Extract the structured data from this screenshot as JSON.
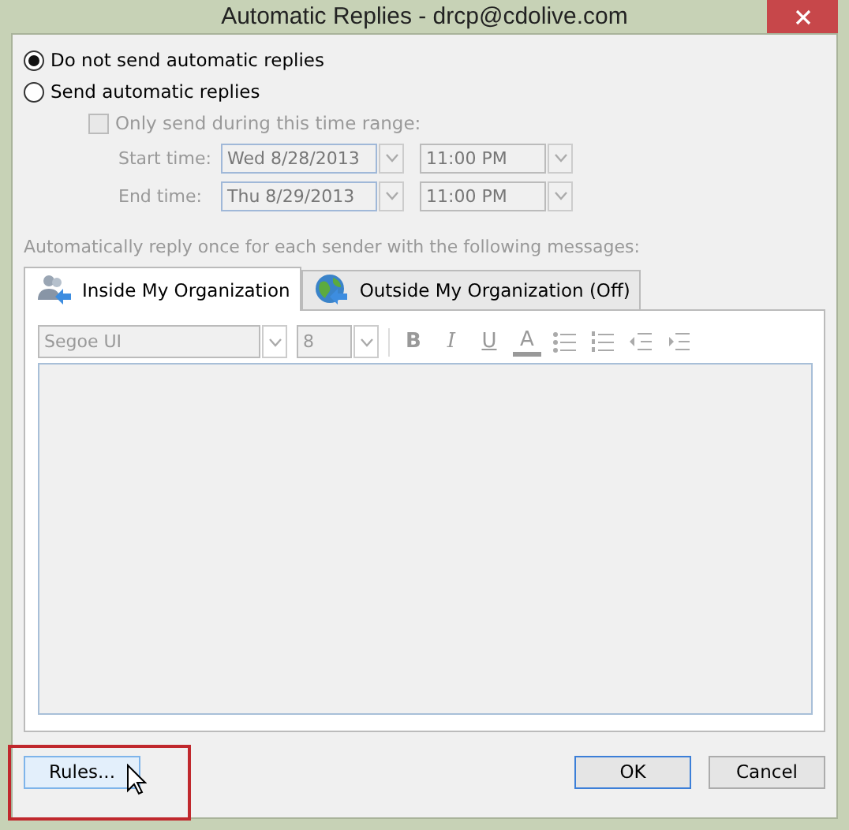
{
  "window": {
    "title": "Automatic Replies - drcp@cdolive.com"
  },
  "modes": [
    {
      "label": "Do not send automatic replies",
      "selected": true
    },
    {
      "label": "Send automatic replies",
      "selected": false
    }
  ],
  "time_range": {
    "label": "Only send during this time range:",
    "checked": false,
    "disabled": true,
    "rows": [
      {
        "label": "Start time:",
        "date": "Wed 8/28/2013",
        "time": "11:00 PM"
      },
      {
        "label": "End time:",
        "date": "Thu 8/29/2013",
        "time": "11:00 PM"
      }
    ]
  },
  "description": "Automatically reply once for each sender with the following messages:",
  "tabs": [
    {
      "label": "Inside My Organization",
      "selected": true,
      "kind": "people"
    },
    {
      "label": "Outside My Organization (Off)",
      "selected": false,
      "kind": "globe"
    }
  ],
  "editor": {
    "font": "Segoe UI",
    "size": "8",
    "disabled": true,
    "tools": [
      {
        "kind": "bold",
        "text": "B"
      },
      {
        "kind": "italic",
        "text": "I"
      },
      {
        "kind": "underline",
        "text": "U"
      },
      {
        "kind": "color",
        "text": "A"
      },
      {
        "kind": "bullets"
      },
      {
        "kind": "numbering"
      },
      {
        "kind": "outdent"
      },
      {
        "kind": "indent"
      }
    ]
  },
  "buttons": [
    {
      "label": "Rules...",
      "kind": "plain",
      "highlighted": true
    },
    {
      "label": "OK",
      "kind": "default",
      "highlighted": false
    },
    {
      "label": "Cancel",
      "kind": "plain",
      "highlighted": false
    }
  ]
}
